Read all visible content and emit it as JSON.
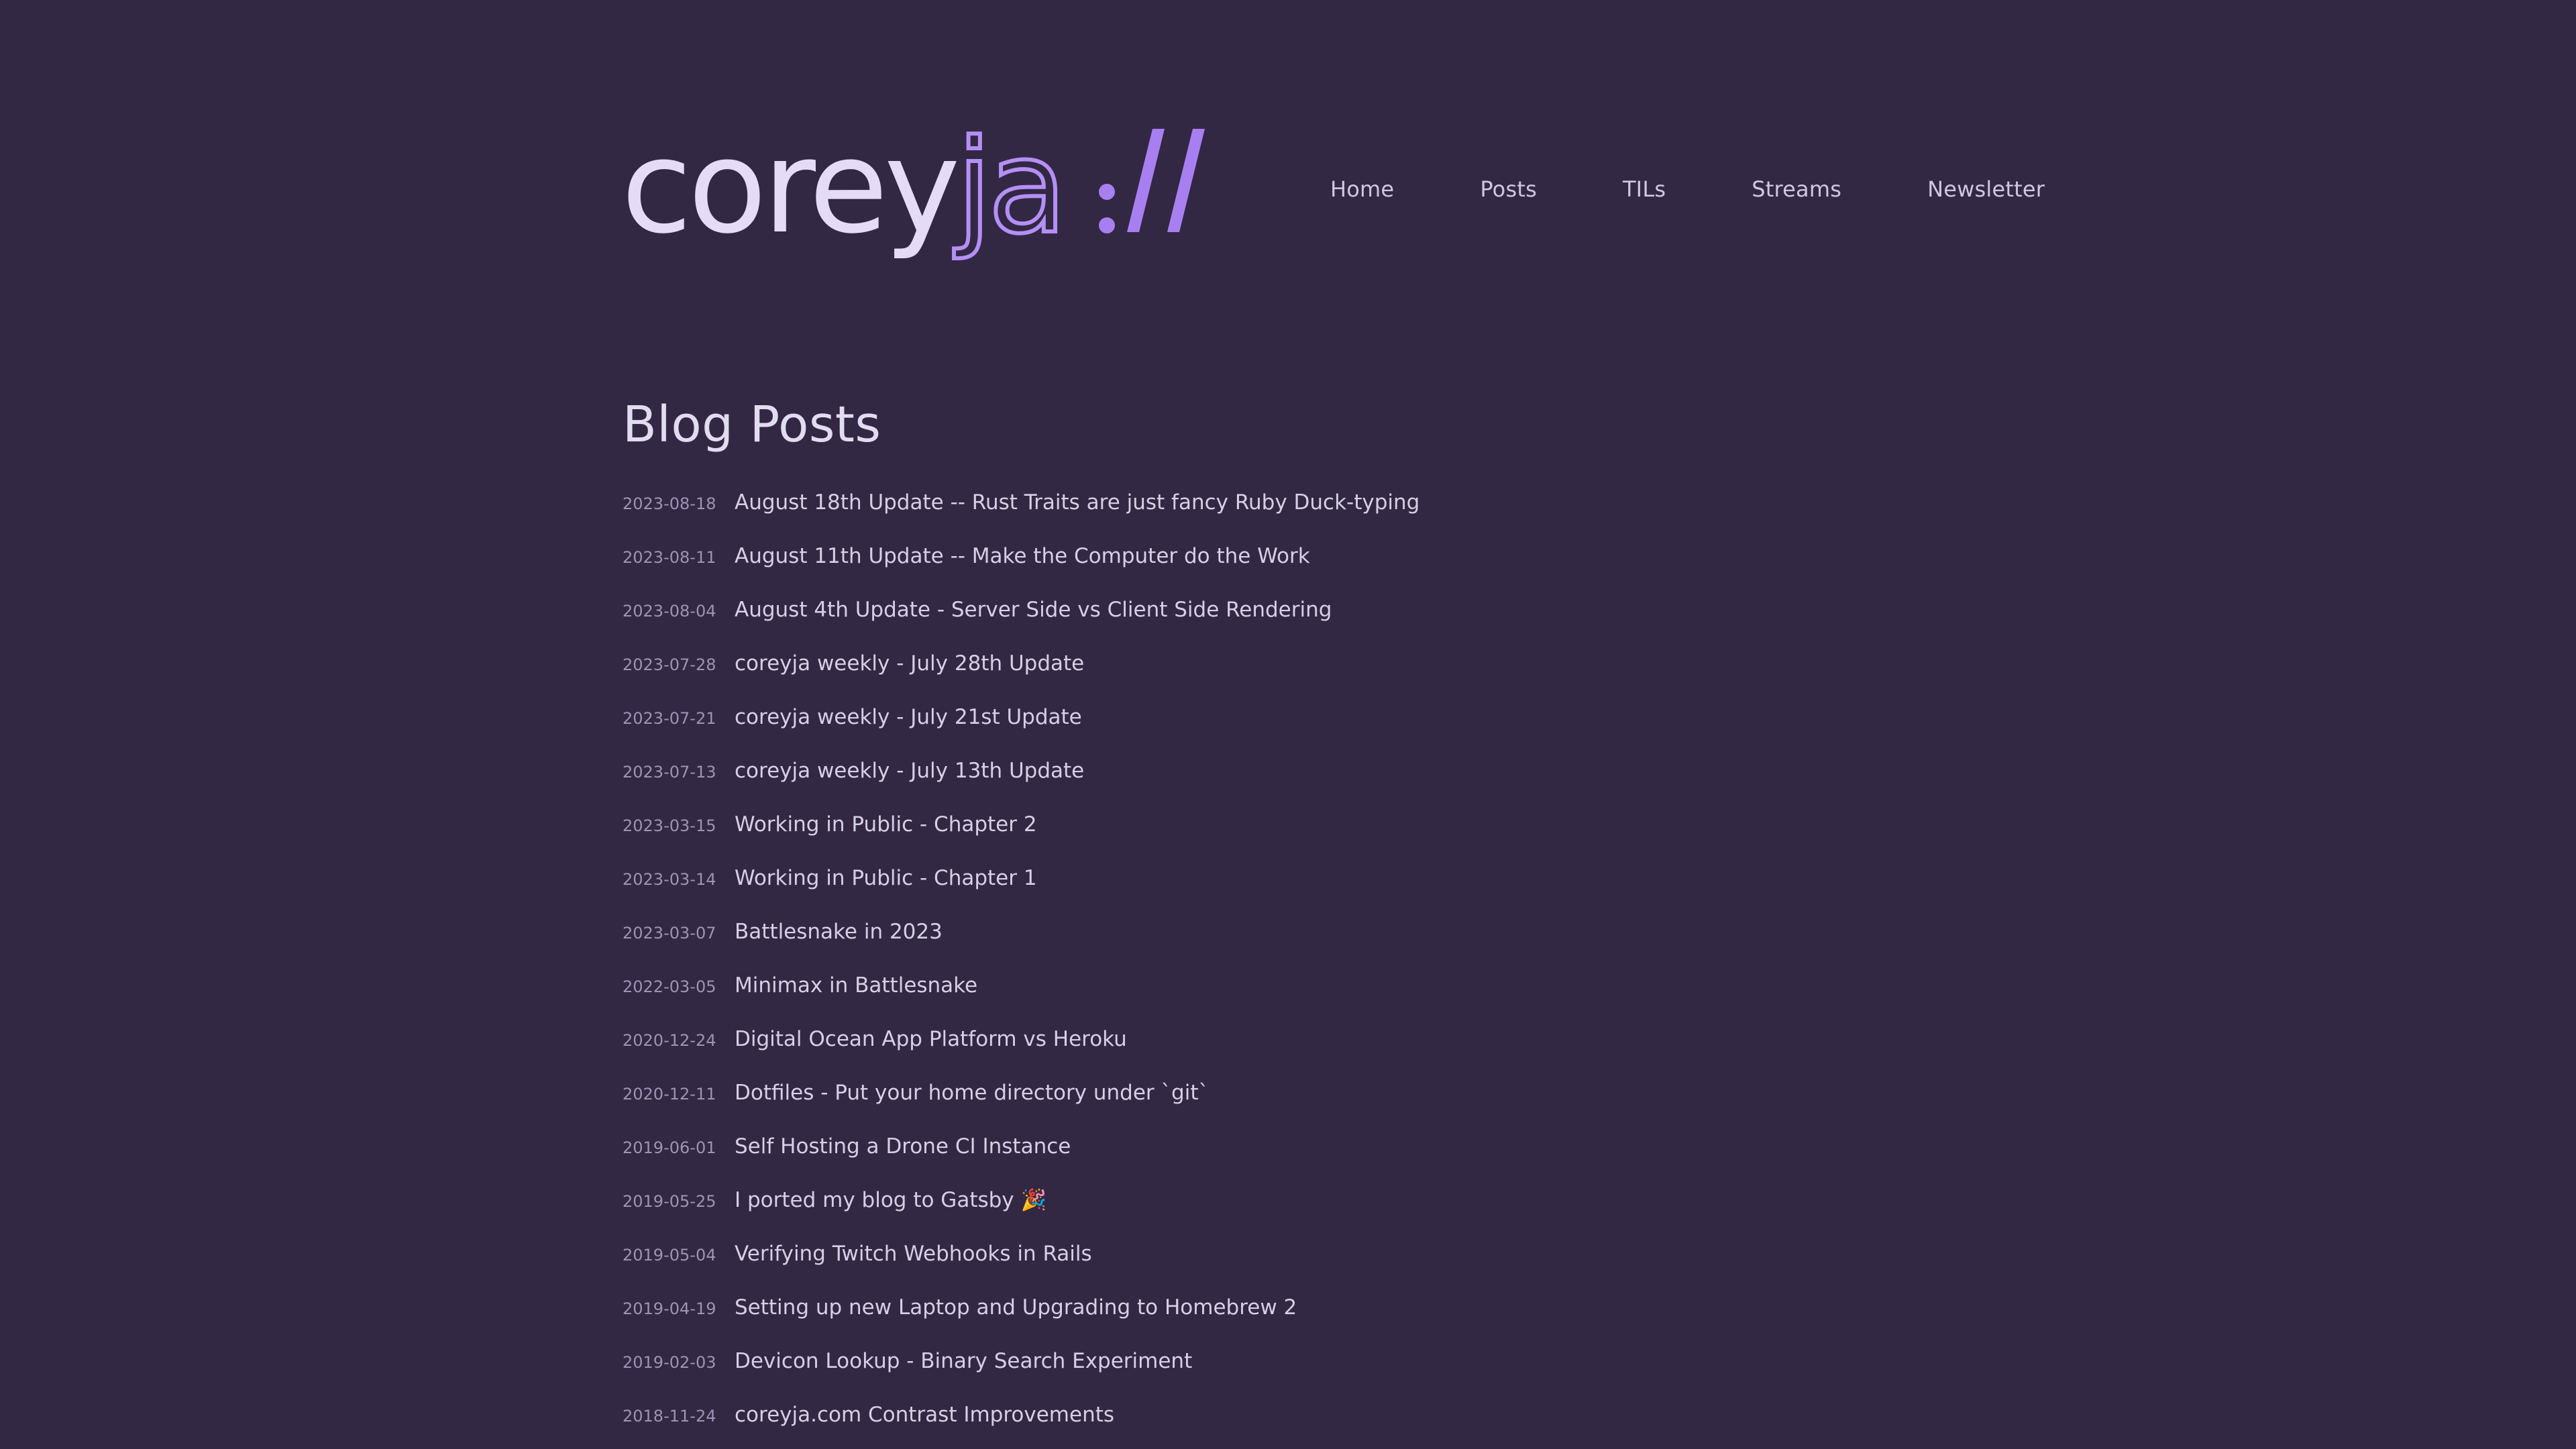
{
  "header": {
    "logo_text_main": "corey",
    "logo_text_accent": "ja",
    "logo_suffix": "://",
    "nav": [
      {
        "label": "Home"
      },
      {
        "label": "Posts"
      },
      {
        "label": "TILs"
      },
      {
        "label": "Streams"
      },
      {
        "label": "Newsletter"
      }
    ]
  },
  "main": {
    "title": "Blog Posts",
    "posts": [
      {
        "date": "2023-08-18",
        "title": "August 18th Update -- Rust Traits are just fancy Ruby Duck-typing"
      },
      {
        "date": "2023-08-11",
        "title": "August 11th Update -- Make the Computer do the Work"
      },
      {
        "date": "2023-08-04",
        "title": "August 4th Update - Server Side vs Client Side Rendering"
      },
      {
        "date": "2023-07-28",
        "title": "coreyja weekly - July 28th Update"
      },
      {
        "date": "2023-07-21",
        "title": "coreyja weekly - July 21st Update"
      },
      {
        "date": "2023-07-13",
        "title": "coreyja weekly - July 13th Update"
      },
      {
        "date": "2023-03-15",
        "title": "Working in Public - Chapter 2"
      },
      {
        "date": "2023-03-14",
        "title": "Working in Public - Chapter 1"
      },
      {
        "date": "2023-03-07",
        "title": "Battlesnake in 2023"
      },
      {
        "date": "2022-03-05",
        "title": "Minimax in Battlesnake"
      },
      {
        "date": "2020-12-24",
        "title": "Digital Ocean App Platform vs Heroku"
      },
      {
        "date": "2020-12-11",
        "title": "Dotfiles - Put your home directory under `git`"
      },
      {
        "date": "2019-06-01",
        "title": "Self Hosting a Drone CI Instance"
      },
      {
        "date": "2019-05-25",
        "title": "I ported my blog to Gatsby 🎉"
      },
      {
        "date": "2019-05-04",
        "title": "Verifying Twitch Webhooks in Rails"
      },
      {
        "date": "2019-04-19",
        "title": "Setting up new Laptop and Upgrading to Homebrew 2"
      },
      {
        "date": "2019-02-03",
        "title": "Devicon Lookup - Binary Search Experiment"
      },
      {
        "date": "2018-11-24",
        "title": "coreyja.com Contrast Improvements"
      }
    ]
  },
  "colors": {
    "background": "#322843",
    "logo_light": "#e4dcf7",
    "logo_accent": "#a87ff0",
    "text": "#d6cfe8",
    "date": "#9d93b4"
  }
}
